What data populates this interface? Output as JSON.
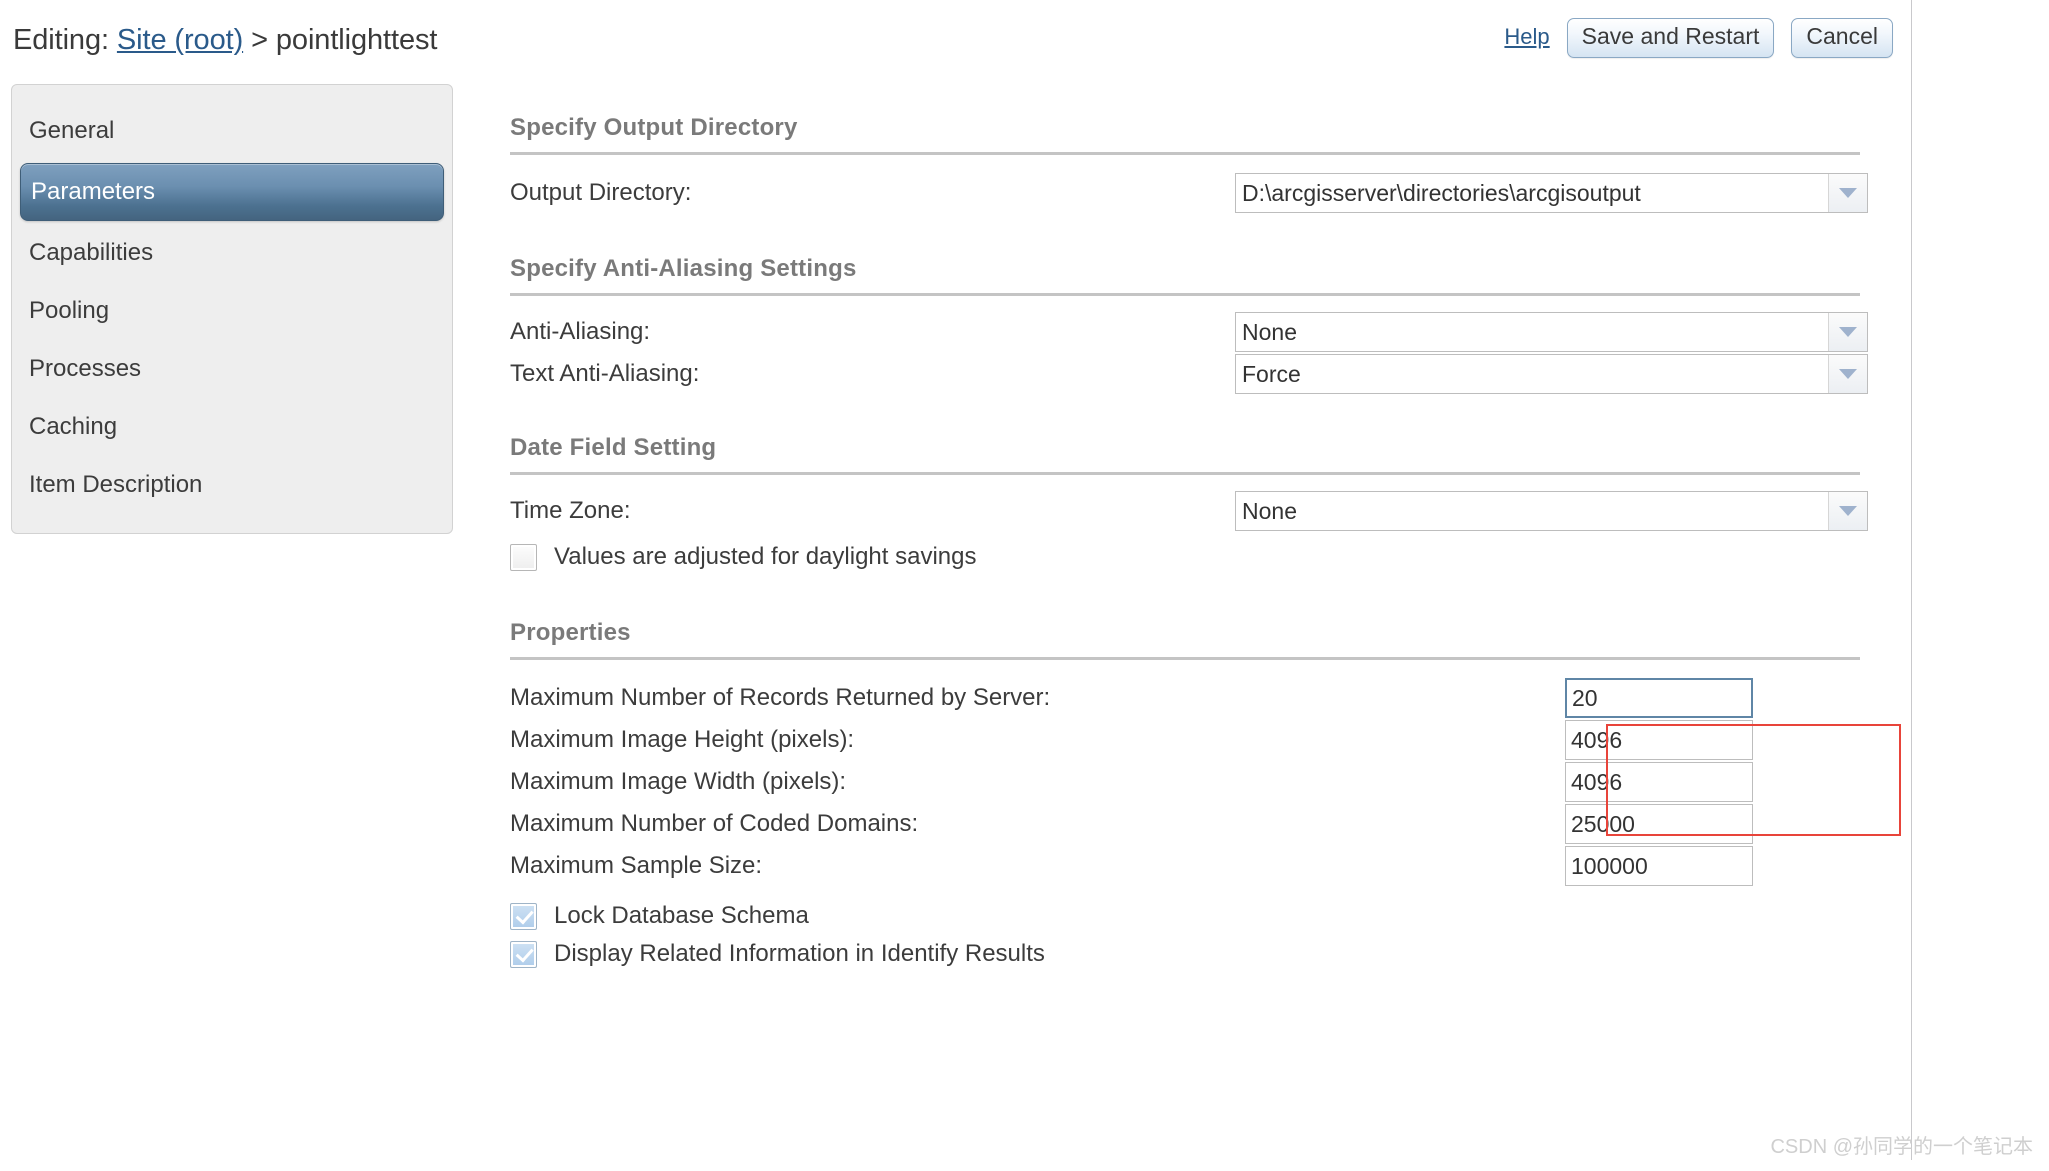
{
  "header": {
    "title_prefix": "Editing:",
    "breadcrumb_link": "Site (root)",
    "breadcrumb_separator": ">",
    "breadcrumb_current": "pointlighttest",
    "help_label": "Help",
    "save_label": "Save and Restart",
    "cancel_label": "Cancel"
  },
  "sidebar": {
    "items": [
      {
        "label": "General",
        "selected": false
      },
      {
        "label": "Parameters",
        "selected": true
      },
      {
        "label": "Capabilities",
        "selected": false
      },
      {
        "label": "Pooling",
        "selected": false
      },
      {
        "label": "Processes",
        "selected": false
      },
      {
        "label": "Caching",
        "selected": false
      },
      {
        "label": "Item Description",
        "selected": false
      }
    ]
  },
  "main": {
    "output_directory_section": {
      "title": "Specify Output Directory",
      "output_directory_label": "Output Directory:",
      "output_directory_value": "D:\\arcgisserver\\directories\\arcgisoutput"
    },
    "antialiasing_section": {
      "title": "Specify Anti-Aliasing Settings",
      "antialiasing_label": "Anti-Aliasing:",
      "antialiasing_value": "None",
      "text_antialiasing_label": "Text Anti-Aliasing:",
      "text_antialiasing_value": "Force"
    },
    "date_field_section": {
      "title": "Date Field Setting",
      "time_zone_label": "Time Zone:",
      "time_zone_value": "None",
      "daylight_savings_label": "Values are adjusted for daylight savings",
      "daylight_savings_checked": false
    },
    "properties_section": {
      "title": "Properties",
      "max_records_label": "Maximum Number of Records Returned by Server:",
      "max_records_value": "20",
      "max_image_height_label": "Maximum Image Height (pixels):",
      "max_image_height_value": "4096",
      "max_image_width_label": "Maximum Image Width (pixels):",
      "max_image_width_value": "4096",
      "max_coded_domains_label": "Maximum Number of Coded Domains:",
      "max_coded_domains_value": "25000",
      "max_sample_size_label": "Maximum Sample Size:",
      "max_sample_size_value": "100000",
      "lock_schema_label": "Lock Database Schema",
      "lock_schema_checked": true,
      "display_related_label": "Display Related Information in Identify Results",
      "display_related_checked": true
    }
  },
  "annotation": {
    "highlight_color": "#e8443a"
  },
  "watermark": {
    "text": "CSDN @孙同学的一个笔记本"
  }
}
